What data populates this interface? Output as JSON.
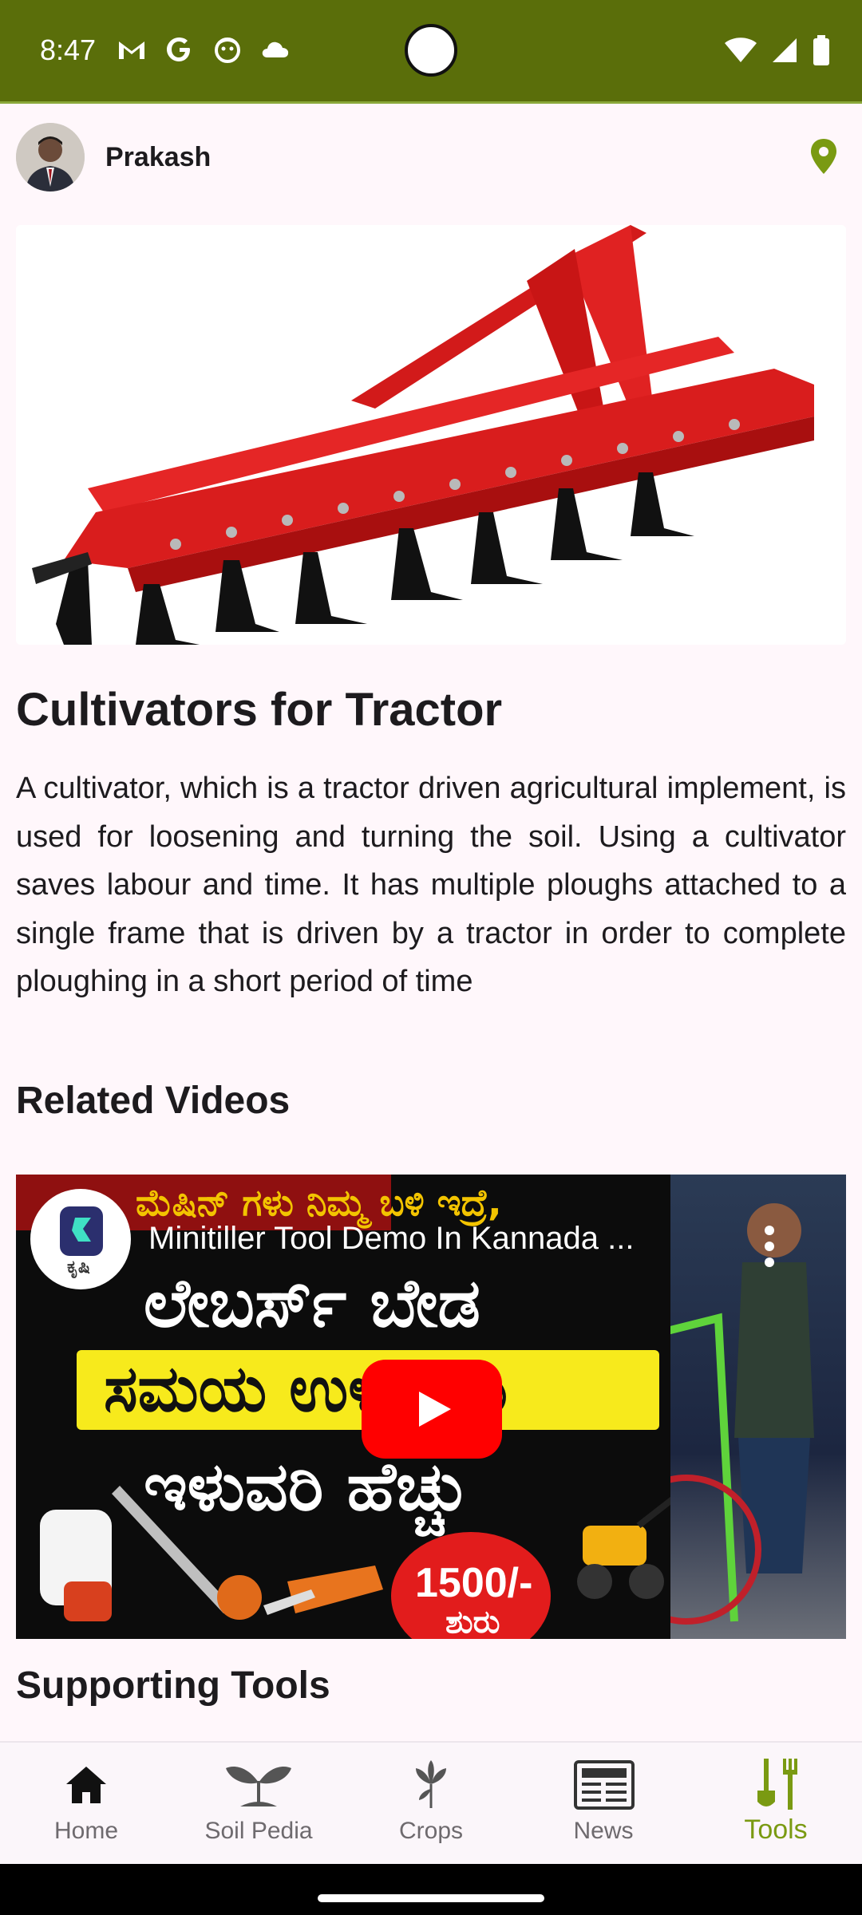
{
  "status_bar": {
    "time": "8:47",
    "left_icons": [
      "gmail-icon",
      "google-icon",
      "face-icon",
      "cloud-icon"
    ],
    "right_icons": [
      "wifi-icon",
      "signal-icon",
      "battery-icon"
    ],
    "background_color": "#5A6E0A"
  },
  "header": {
    "user_name": "Prakash",
    "location_icon_color": "#7a9a12"
  },
  "article": {
    "title": "Cultivators for Tractor",
    "description": "A cultivator, which is a tractor driven agricultural implement, is used for loosening and turning the soil. Using a cultivator saves labour and time. It has multiple ploughs attached to a single frame that is driven by a tractor in order to complete ploughing in a short period of time"
  },
  "related_videos": {
    "heading": "Related Videos",
    "video": {
      "title": "Minitiller Tool Demo In Kannada ...",
      "channel_logo_text": "ಕೃಷಿ",
      "thumbnail_line1": "ಮೆಷಿನ್ ಗಳು ನಿಮ್ಮ ಬಳಿ ಇದ್ರೆ,",
      "thumbnail_line2": "ಲೇಬರ್ಸ್ ಬೇಡ",
      "thumbnail_line3": "ಸಮಯ ಉಳಿತಾಯ",
      "thumbnail_line4": "ಇಳುವರಿ ಹೆಚ್ಚು",
      "price_line1": "1500/-",
      "price_line2": "ಶುರು"
    }
  },
  "supporting_tools": {
    "heading": "Supporting Tools"
  },
  "bottom_nav": {
    "items": [
      {
        "label": "Home",
        "icon": "home-icon",
        "active": false
      },
      {
        "label": "Soil Pedia",
        "icon": "plant-icon",
        "active": false
      },
      {
        "label": "Crops",
        "icon": "crop-icon",
        "active": false
      },
      {
        "label": "News",
        "icon": "newspaper-icon",
        "active": false
      },
      {
        "label": "Tools",
        "icon": "tools-icon",
        "active": true
      }
    ],
    "active_color": "#7a9a12"
  }
}
